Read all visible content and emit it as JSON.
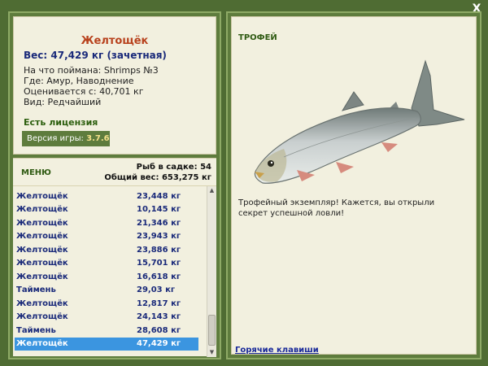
{
  "close_label": "X",
  "fish": {
    "title": "Желтощёк",
    "weight": "Вес: 47,429 кг (зачетная)",
    "bait": "На что поймана: Shrimps №3",
    "location": "Где: Амур, Наводнение",
    "value": "Оценивается с: 40,701 кг",
    "rarity": "Вид: Редчайший"
  },
  "license": "Есть лицензия",
  "version": {
    "label": "Версия игры:",
    "value": "3.7.6"
  },
  "menu": {
    "label": "МЕНЮ",
    "catch_count": "Рыб в садке: 54",
    "total_weight": "Общий вес: 653,275 кг"
  },
  "list": [
    {
      "name": "Желтощёк",
      "weight": "23,448 кг"
    },
    {
      "name": "Желтощёк",
      "weight": "10,145 кг"
    },
    {
      "name": "Желтощёк",
      "weight": "21,346 кг"
    },
    {
      "name": "Желтощёк",
      "weight": "23,943 кг"
    },
    {
      "name": "Желтощёк",
      "weight": "23,886 кг"
    },
    {
      "name": "Желтощёк",
      "weight": "15,701 кг"
    },
    {
      "name": "Желтощёк",
      "weight": "16,618 кг"
    },
    {
      "name": "Таймень",
      "weight": "29,03 кг"
    },
    {
      "name": "Желтощёк",
      "weight": "12,817 кг"
    },
    {
      "name": "Желтощёк",
      "weight": "24,143 кг"
    },
    {
      "name": "Таймень",
      "weight": "28,608 кг"
    },
    {
      "name": "Желтощёк",
      "weight": "47,429 кг"
    }
  ],
  "selected_index": 11,
  "trophy": {
    "label": "ТРОФЕЙ",
    "text": "Трофейный экземпляр! Кажется, вы открыли секрет успешной ловли!",
    "image_icon": "fish-image"
  },
  "hotkeys": "Горячие клавиши",
  "colors": {
    "background": "#4f6c33",
    "panel": "#f2f0df",
    "title": "#b8421d",
    "selected": "#3b95e0"
  }
}
